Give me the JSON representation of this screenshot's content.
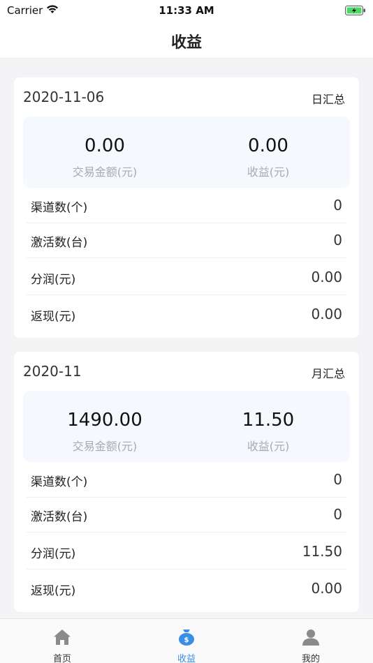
{
  "status_bar": {
    "carrier": "Carrier",
    "time": "11:33 AM"
  },
  "nav": {
    "title": "收益"
  },
  "cards": [
    {
      "date": "2020-11-06",
      "period": "日汇总",
      "summary": {
        "transaction_amount": "0.00",
        "transaction_label": "交易金额(元)",
        "earnings": "0.00",
        "earnings_label": "收益(元)"
      },
      "rows": [
        {
          "label": "渠道数(个)",
          "value": "0"
        },
        {
          "label": "激活数(台)",
          "value": "0"
        },
        {
          "label": "分润(元)",
          "value": "0.00"
        },
        {
          "label": "返现(元)",
          "value": "0.00"
        }
      ]
    },
    {
      "date": "2020-11",
      "period": "月汇总",
      "summary": {
        "transaction_amount": "1490.00",
        "transaction_label": "交易金额(元)",
        "earnings": "11.50",
        "earnings_label": "收益(元)"
      },
      "rows": [
        {
          "label": "渠道数(个)",
          "value": "0"
        },
        {
          "label": "激活数(台)",
          "value": "0"
        },
        {
          "label": "分润(元)",
          "value": "11.50"
        },
        {
          "label": "返现(元)",
          "value": "0.00"
        }
      ]
    }
  ],
  "tab_bar": {
    "tabs": [
      {
        "label": "首页",
        "icon": "home-icon"
      },
      {
        "label": "收益",
        "icon": "money-bag-icon",
        "active": true
      },
      {
        "label": "我的",
        "icon": "person-icon"
      }
    ]
  },
  "colors": {
    "accent": "#3a8ee6",
    "summary_bg": "#f5f9fe",
    "page_bg": "#f4f4f6"
  }
}
